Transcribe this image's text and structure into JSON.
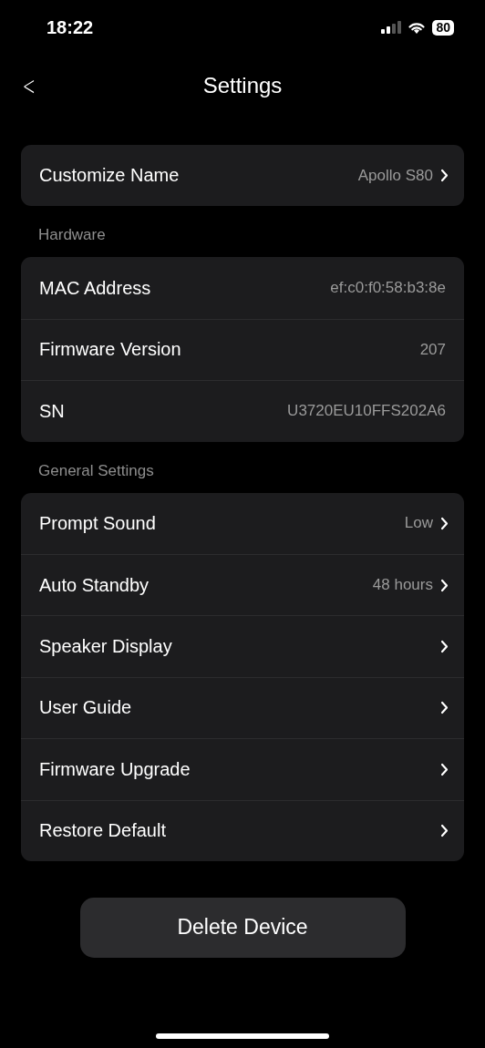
{
  "status_bar": {
    "time": "18:22",
    "battery": "80"
  },
  "header": {
    "back": "<",
    "title": "Settings"
  },
  "sections": [
    {
      "rows": [
        {
          "kind": "link",
          "label": "Customize Name",
          "value": "Apollo S80"
        }
      ]
    },
    {
      "title": "Hardware",
      "rows": [
        {
          "kind": "info",
          "label": "MAC Address",
          "value": "ef:c0:f0:58:b3:8e"
        },
        {
          "kind": "info",
          "label": "Firmware Version",
          "value": "207"
        },
        {
          "kind": "info",
          "label": "SN",
          "value": "U3720EU10FFS202A6"
        }
      ]
    },
    {
      "title": "General Settings",
      "rows": [
        {
          "kind": "link",
          "label": "Prompt Sound",
          "value": "Low"
        },
        {
          "kind": "link",
          "label": "Auto Standby",
          "value": "48 hours"
        },
        {
          "kind": "link",
          "label": "Speaker Display"
        },
        {
          "kind": "link",
          "label": "User Guide"
        },
        {
          "kind": "link",
          "label": "Firmware Upgrade"
        },
        {
          "kind": "link",
          "label": "Restore Default"
        }
      ]
    }
  ],
  "delete_button": "Delete Device"
}
